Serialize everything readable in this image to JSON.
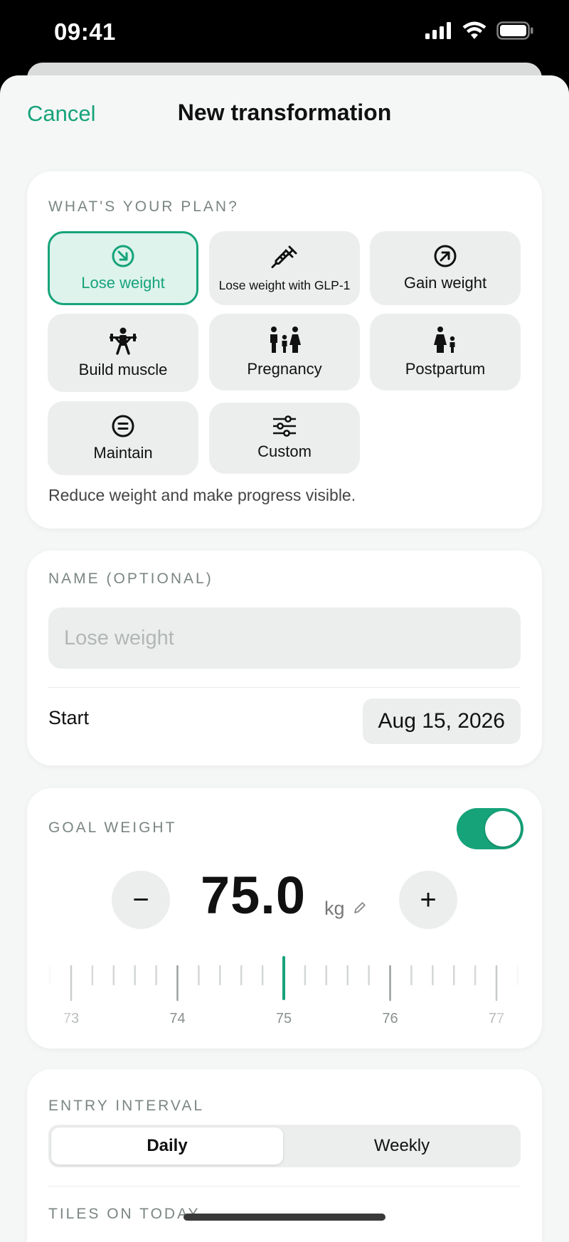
{
  "status_bar": {
    "time": "09:41"
  },
  "nav": {
    "cancel_label": "Cancel",
    "title": "New transformation"
  },
  "plan": {
    "section_label": "WHAT'S YOUR PLAN?",
    "options": [
      {
        "label": "Lose weight",
        "icon": "arrow-down-right-circle-icon",
        "selected": true
      },
      {
        "label": "Lose weight with GLP-1",
        "icon": "syringe-icon",
        "selected": false
      },
      {
        "label": "Gain weight",
        "icon": "arrow-up-right-circle-icon",
        "selected": false
      },
      {
        "label": "Build muscle",
        "icon": "weightlifter-icon",
        "selected": false
      },
      {
        "label": "Pregnancy",
        "icon": "family-icon",
        "selected": false
      },
      {
        "label": "Postpartum",
        "icon": "parent-child-icon",
        "selected": false
      },
      {
        "label": "Maintain",
        "icon": "equals-circle-icon",
        "selected": false
      },
      {
        "label": "Custom",
        "icon": "sliders-icon",
        "selected": false
      }
    ],
    "description": "Reduce weight and make progress visible."
  },
  "name_card": {
    "section_label": "NAME (OPTIONAL)",
    "name_placeholder": "Lose weight",
    "name_value": "",
    "start_label": "Start",
    "start_date": "Aug 15, 2026"
  },
  "goal": {
    "section_label": "GOAL WEIGHT",
    "enabled": true,
    "value": "75.0",
    "unit": "kg",
    "minus_label": "−",
    "plus_label": "+",
    "ruler_labels": [
      "73",
      "74",
      "75",
      "76",
      "77"
    ],
    "ruler_selected": "75"
  },
  "interval": {
    "section_label": "ENTRY INTERVAL",
    "options": [
      "Daily",
      "Weekly"
    ],
    "selected": "Daily"
  },
  "tiles": {
    "section_label": "TILES ON TODAY"
  },
  "colors": {
    "accent": "#16a37a",
    "accent_light": "#ddf3ec",
    "tile_bg": "#eceeed",
    "sheet_bg": "#f5f7f6"
  }
}
